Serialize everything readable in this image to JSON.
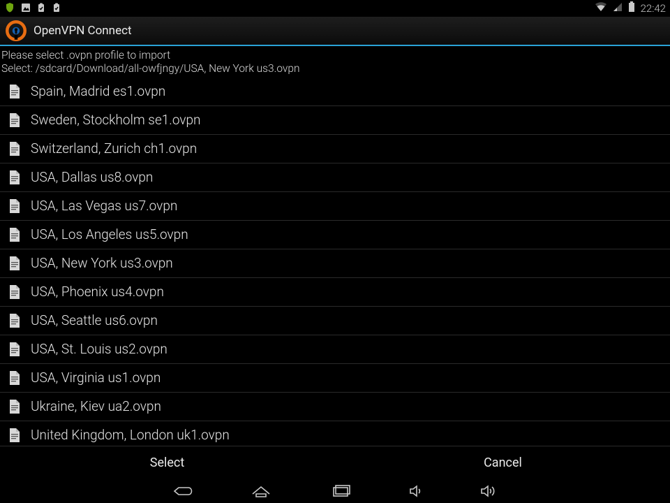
{
  "status": {
    "clock": "22:42"
  },
  "app": {
    "title": "OpenVPN Connect"
  },
  "subheader": {
    "line1": "Please select .ovpn profile to import",
    "line2": "Select: /sdcard/Download/all-owfjngy/USA, New York us3.ovpn"
  },
  "files": [
    "Spain, Madrid es1.ovpn",
    "Sweden, Stockholm se1.ovpn",
    "Switzerland, Zurich ch1.ovpn",
    "USA, Dallas us8.ovpn",
    "USA, Las Vegas us7.ovpn",
    "USA, Los Angeles us5.ovpn",
    "USA, New York us3.ovpn",
    "USA, Phoenix us4.ovpn",
    "USA, Seattle us6.ovpn",
    "USA, St. Louis us2.ovpn",
    "USA, Virginia us1.ovpn",
    "Ukraine, Kiev ua2.ovpn",
    "United Kingdom, London uk1.ovpn"
  ],
  "buttons": {
    "select": "Select",
    "cancel": "Cancel"
  }
}
